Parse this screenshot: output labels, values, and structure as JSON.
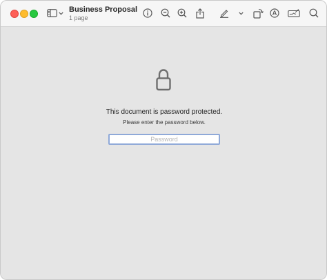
{
  "window": {
    "title": "Business Proposal",
    "subtitle": "1 page"
  },
  "toolbar": {
    "icons": [
      "sidebar-icon",
      "chevron-down-icon",
      "info-icon",
      "zoom-out-icon",
      "zoom-in-icon",
      "share-icon",
      "markup-pen-icon",
      "chevron-down-icon",
      "rotate-icon",
      "markup-icon",
      "signature-icon",
      "search-icon"
    ]
  },
  "locked": {
    "icon": "lock-icon",
    "message": "This document is password protected.",
    "prompt": "Please enter the password below.",
    "password_placeholder": "Password",
    "password_value": ""
  },
  "colors": {
    "content_background": "#e5e5e5",
    "toolbar_background": "#f6f6f6",
    "focus_ring": "#8fa9d8",
    "close": "#fe5f57",
    "minimize": "#febc2e",
    "zoom": "#28c840"
  }
}
